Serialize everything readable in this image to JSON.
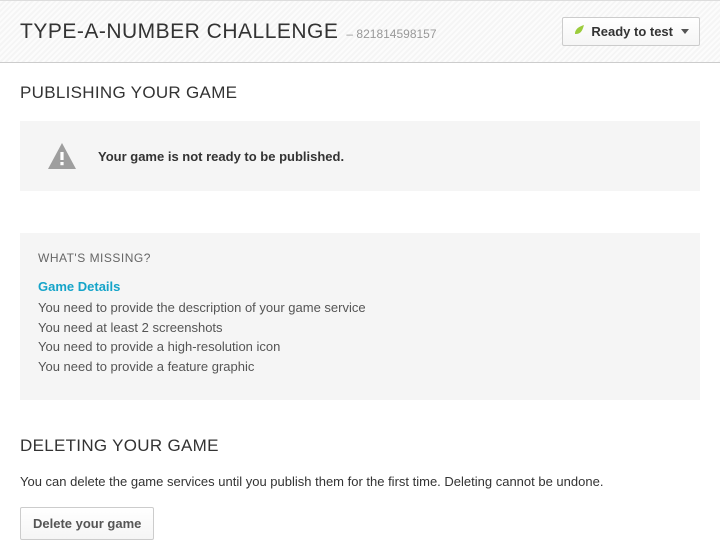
{
  "header": {
    "title": "TYPE-A-NUMBER CHALLENGE",
    "app_id_prefix": "–",
    "app_id": "821814598157",
    "ready_label": "Ready to test"
  },
  "publishing": {
    "section_title": "PUBLISHING YOUR GAME",
    "alert_message": "Your game is not ready to be published.",
    "missing_title": "WHAT'S MISSING?",
    "game_details_link": "Game Details",
    "missing_items": [
      "You need to provide the description of your game service",
      "You need at least 2 screenshots",
      "You need to provide a high-resolution icon",
      "You need to provide a feature graphic"
    ]
  },
  "deleting": {
    "section_title": "DELETING YOUR GAME",
    "description": "You can delete the game services until you publish them for the first time. Deleting cannot be undone.",
    "button_label": "Delete your game"
  }
}
